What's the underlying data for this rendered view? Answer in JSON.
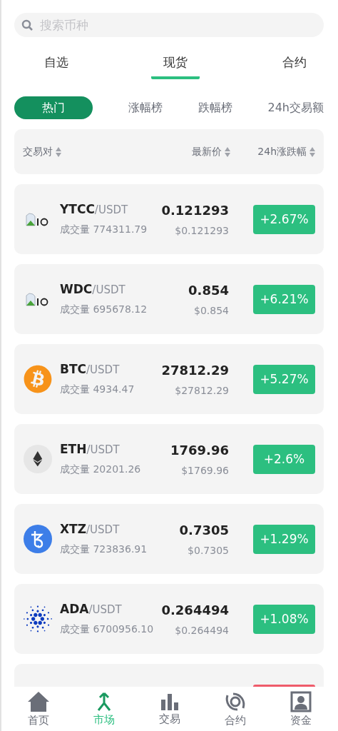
{
  "search": {
    "placeholder": "搜索币种"
  },
  "tabs": [
    {
      "label": "自选",
      "selected": false
    },
    {
      "label": "现货",
      "selected": true
    },
    {
      "label": "合约",
      "selected": false
    }
  ],
  "filters": [
    {
      "label": "热门",
      "selected": true
    },
    {
      "label": "涨幅榜",
      "selected": false
    },
    {
      "label": "跌幅榜",
      "selected": false
    },
    {
      "label": "24h交易额",
      "selected": false
    }
  ],
  "table": {
    "columns": [
      "交易对",
      "最新价",
      "24h涨跌幅"
    ],
    "rows": [
      {
        "kind": "broken",
        "base": "YTCC",
        "quote": "/USDT",
        "volume_label": "成交量",
        "volume": "774311.79",
        "price": "0.121293",
        "price_usd": "$0.121293",
        "change": "+2.67%",
        "rising": true
      },
      {
        "kind": "broken",
        "base": "WDC",
        "quote": "/USDT",
        "volume_label": "成交量",
        "volume": "695678.12",
        "price": "0.854",
        "price_usd": "$0.854",
        "change": "+6.21%",
        "rising": true
      },
      {
        "kind": "btc",
        "base": "BTC",
        "quote": "/USDT",
        "volume_label": "成交量",
        "volume": "4934.47",
        "price": "27812.29",
        "price_usd": "$27812.29",
        "change": "+5.27%",
        "rising": true
      },
      {
        "kind": "eth",
        "base": "ETH",
        "quote": "/USDT",
        "volume_label": "成交量",
        "volume": "20201.26",
        "price": "1769.96",
        "price_usd": "$1769.96",
        "change": "+2.6%",
        "rising": true
      },
      {
        "kind": "xtz",
        "base": "XTZ",
        "quote": "/USDT",
        "volume_label": "成交量",
        "volume": "723836.91",
        "price": "0.7305",
        "price_usd": "$0.7305",
        "change": "+1.29%",
        "rising": true
      },
      {
        "kind": "ada",
        "base": "ADA",
        "quote": "/USDT",
        "volume_label": "成交量",
        "volume": "6700956.10",
        "price": "0.264494",
        "price_usd": "$0.264494",
        "change": "+1.08%",
        "rising": true
      }
    ],
    "partial_row": {
      "rising": false
    }
  },
  "nav": [
    {
      "label": "首页",
      "kind": "home",
      "selected": false
    },
    {
      "label": "市场",
      "kind": "market",
      "selected": true
    },
    {
      "label": "交易",
      "kind": "trade",
      "selected": false
    },
    {
      "label": "合约",
      "kind": "contract",
      "selected": false
    },
    {
      "label": "资金",
      "kind": "assets",
      "selected": false
    }
  ]
}
